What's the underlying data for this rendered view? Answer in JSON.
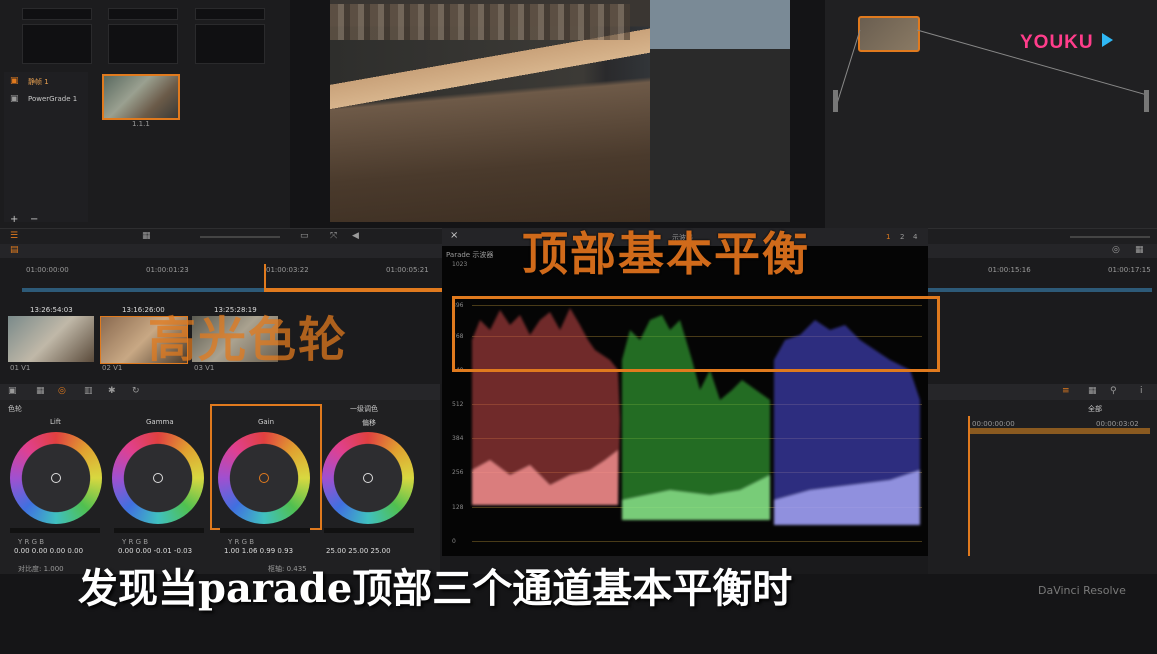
{
  "watermark": {
    "text": "YOUKU",
    "brand_color": "#ff3d8b"
  },
  "gallery": {
    "items": [
      {
        "label": "静帧 1",
        "active": true
      },
      {
        "label": "PowerGrade 1",
        "active": false
      }
    ],
    "still_label": "1.1.1",
    "add": "+",
    "remove": "−"
  },
  "timeline": {
    "ticks": [
      "01:00:00:00",
      "01:00:01:23",
      "01:00:03:22",
      "01:00:05:21",
      "01:00:15:16",
      "01:00:17:15"
    ],
    "clips": [
      {
        "tc": "13:26:54:03",
        "label": "01  V1"
      },
      {
        "tc": "13:16:26:00",
        "label": "02  V1"
      },
      {
        "tc": "13:25:28:19",
        "label": "03  V1"
      }
    ]
  },
  "color": {
    "section_label": "色轮",
    "mode_label": "一级调色",
    "wheels": [
      {
        "name": "Lift",
        "values": "0.00  0.00  0.00  0.00"
      },
      {
        "name": "Gamma",
        "values": "0.00  0.00  -0.01  -0.03"
      },
      {
        "name": "Gain",
        "values": "1.00  1.06  0.99  0.93"
      },
      {
        "name": "偏移",
        "values": "25.00  25.00  25.00"
      }
    ],
    "channels": "Y  R  G  B",
    "contrast": "对比度: 1.000",
    "pivot": "枢轴: 0.435"
  },
  "scope": {
    "title": "示波器",
    "mode": "Parade 示波器",
    "close": "×",
    "pages": [
      "1",
      "2",
      "4"
    ],
    "y_labels": [
      "1023",
      "896",
      "768",
      "640",
      "512",
      "384",
      "256",
      "128",
      "0"
    ]
  },
  "keyframes": {
    "label": "全部",
    "tc_start": "00:00:00:00",
    "tc_end": "00:00:03:02"
  },
  "overlays": {
    "top_balance": "顶部基本平衡",
    "highlight_wheel": "高光色轮",
    "subtitle": "发现当parade顶部三个通道基本平衡时",
    "accent": "#e07a1e"
  },
  "app": {
    "name": "DaVinci Resolve"
  }
}
